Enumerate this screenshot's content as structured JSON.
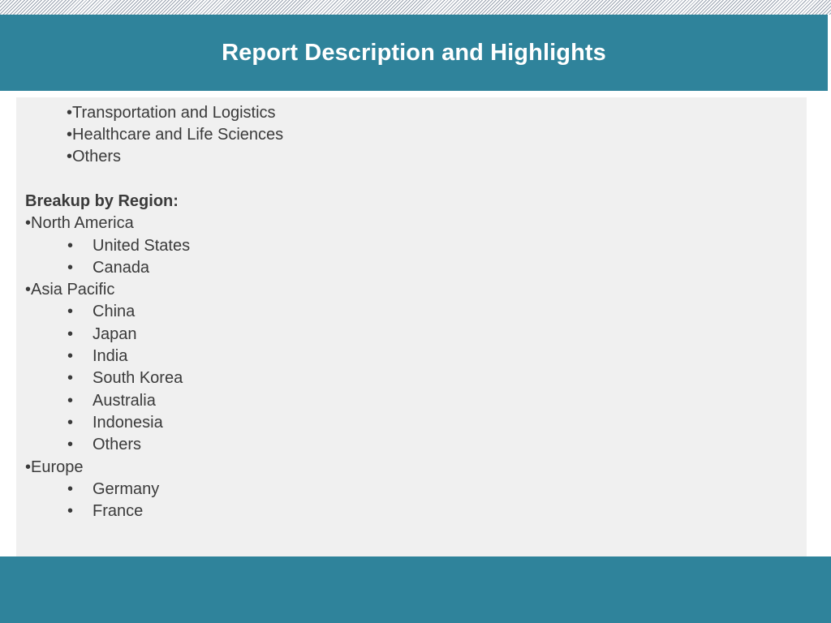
{
  "slide": {
    "title": "Report Description and Highlights"
  },
  "content": {
    "industry_items": [
      "•Transportation and Logistics",
      "•Healthcare and Life Sciences",
      "•Others"
    ],
    "region_heading": "Breakup by Region:",
    "regions": [
      {
        "name": "•North America",
        "countries": [
          "United States",
          "Canada"
        ]
      },
      {
        "name": "•Asia Pacific",
        "countries": [
          "China",
          "Japan",
          "India",
          "South Korea",
          "Australia",
          "Indonesia",
          "Others"
        ]
      },
      {
        "name": "•Europe",
        "countries": [
          "Germany",
          "France"
        ]
      }
    ],
    "sub_bullet_glyph": "•"
  },
  "colors": {
    "header_bg": "#2f839b",
    "content_bg": "#f0f0f0",
    "text": "#3a3a3a"
  }
}
